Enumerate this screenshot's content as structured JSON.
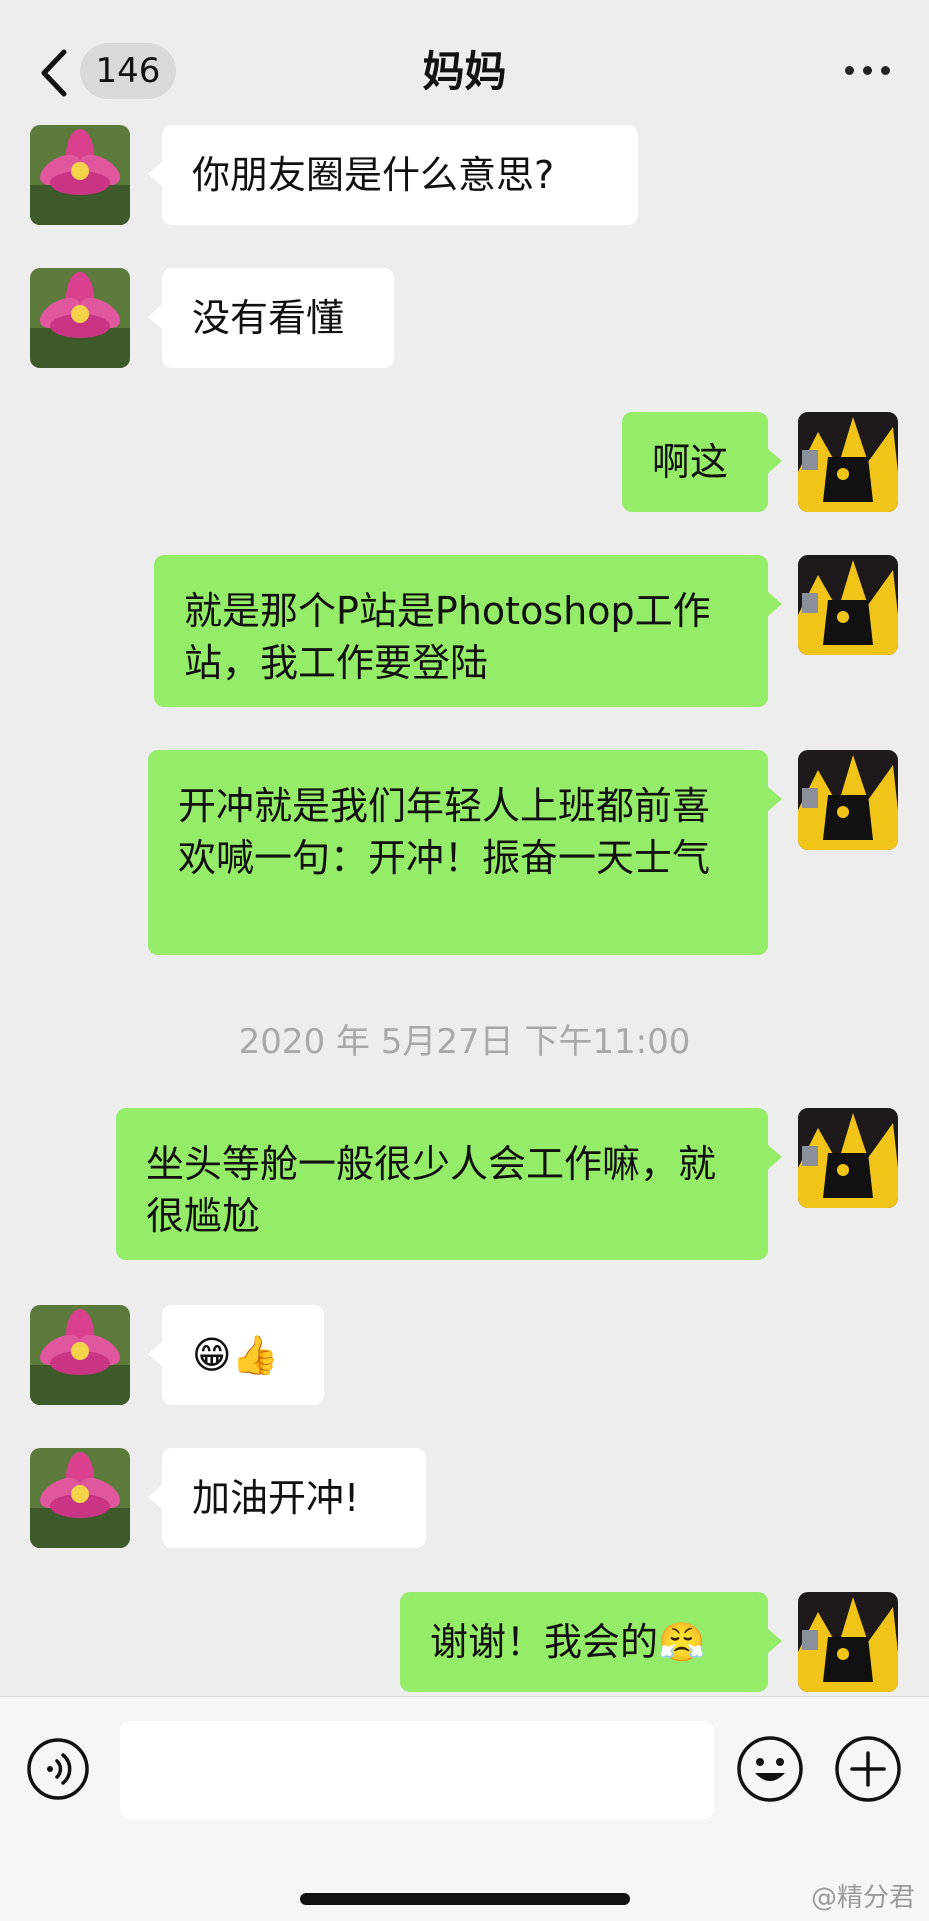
{
  "header": {
    "back_icon": "chevron-left-icon",
    "unread_count": "146",
    "title": "妈妈",
    "more_icon": "more-dots-icon"
  },
  "messages": [
    {
      "side": "left",
      "text": "你朋友圈是什么意思?"
    },
    {
      "side": "left",
      "text": "没有看懂"
    },
    {
      "side": "right",
      "text": "啊这"
    },
    {
      "side": "right",
      "text": "就是那个P站是Photoshop工作站，我工作要登陆"
    },
    {
      "side": "right",
      "text": "开冲就是我们年轻人上班都前喜欢喊一句：开冲！振奋一天士气"
    },
    {
      "side": "right",
      "text": "坐头等舱一般很少人会工作嘛，就很尴尬"
    },
    {
      "side": "left",
      "text": "😁👍"
    },
    {
      "side": "left",
      "text": "加油开冲!"
    },
    {
      "side": "right",
      "text": "谢谢！我会的😤"
    }
  ],
  "timestamp": "2020 年 5月27日 下午11:00",
  "input_bar": {
    "voice_icon": "voice-icon",
    "emoji_icon": "emoji-face-icon",
    "plus_icon": "plus-circle-icon",
    "input_value": ""
  },
  "watermark": "@精分君",
  "colors": {
    "background": "#ededed",
    "bubble_mine": "#95ec69",
    "bubble_theirs": "#ffffff",
    "timestamp": "#a8a8a8"
  }
}
